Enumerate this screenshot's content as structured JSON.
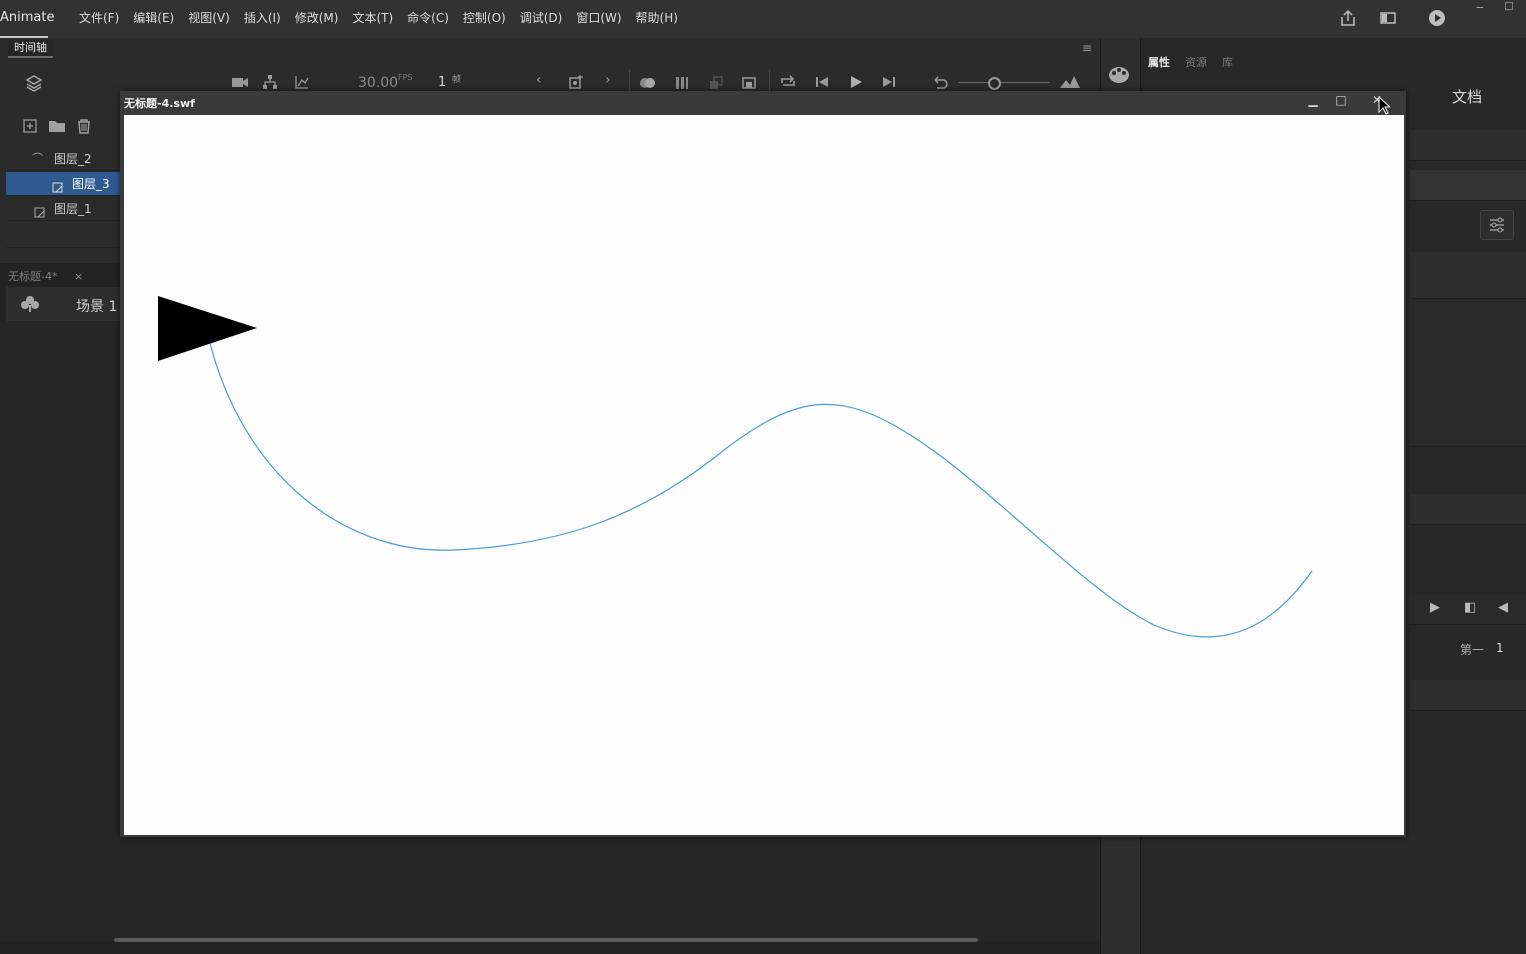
{
  "app": {
    "name": "Animate",
    "menus": [
      "文件(F)",
      "编辑(E)",
      "视图(V)",
      "插入(I)",
      "修改(M)",
      "文本(T)",
      "命令(C)",
      "控制(O)",
      "调试(D)",
      "窗口(W)",
      "帮助(H)"
    ]
  },
  "timeline": {
    "tab": "时间轴",
    "fps": "30.00",
    "fps_unit": "FPS",
    "frame": "1",
    "frame_unit": "帧",
    "layers": [
      {
        "name": "图层_2",
        "type": "guide"
      },
      {
        "name": "图层_3",
        "type": "normal",
        "selected": true
      },
      {
        "name": "图层_1",
        "type": "normal"
      }
    ]
  },
  "document": {
    "tab": "无标题-4*",
    "scene": "场景 1"
  },
  "properties": {
    "tabs": [
      "属性",
      "资源",
      "库"
    ],
    "doc_label": "文档",
    "frame_label": "第一",
    "frame_value": "1"
  },
  "swf_window": {
    "title": "无标题-4.swf"
  },
  "colors": {
    "curve": "#4a9ed6",
    "selection": "#2f5a91",
    "arrow": "#000000"
  }
}
